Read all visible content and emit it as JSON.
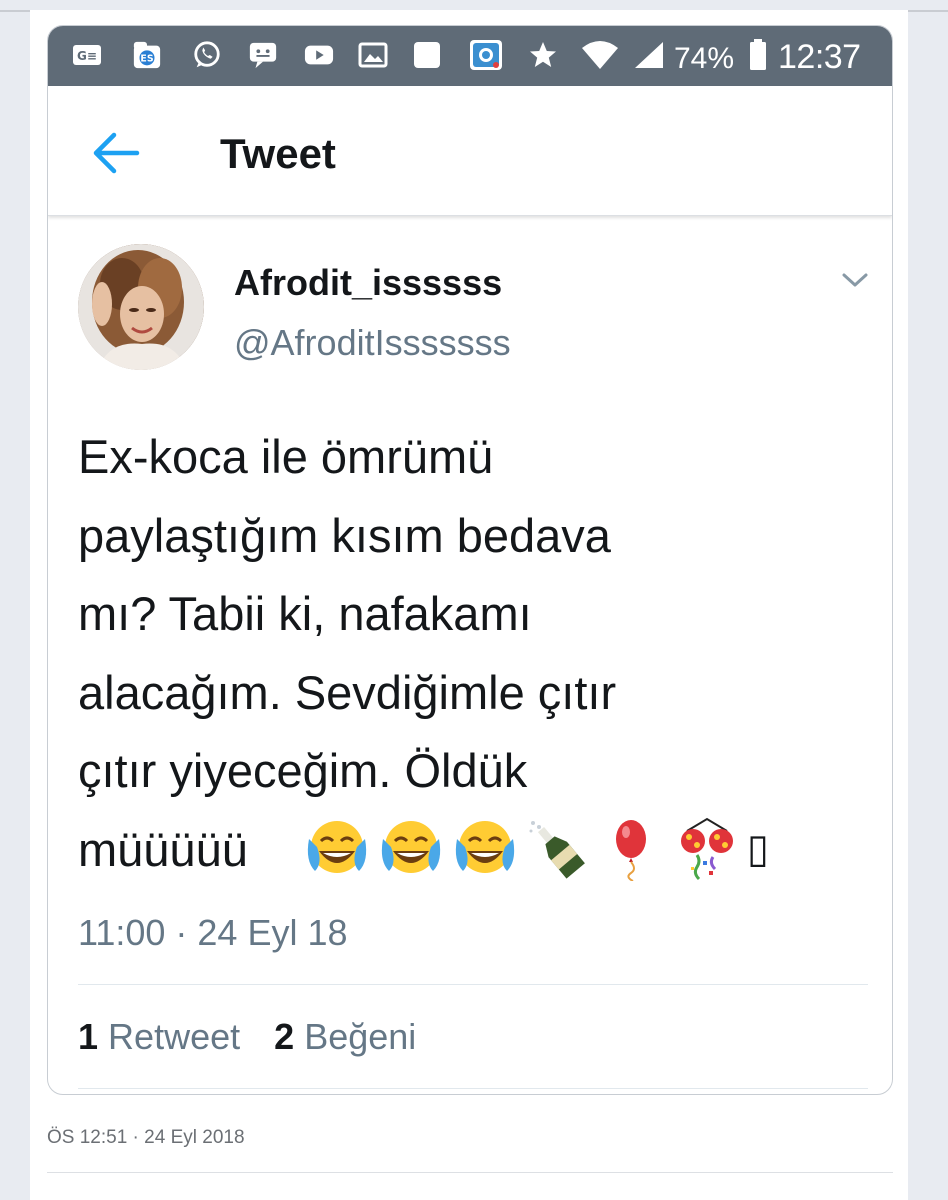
{
  "statusbar": {
    "battery": "74%",
    "time": "12:37",
    "icons": [
      "ge-app-icon",
      "es-file-explorer-icon",
      "whatsapp-icon",
      "messenger-icon",
      "youtube-icon",
      "gallery-icon",
      "blank-app-icon",
      "app-icon",
      "star-icon",
      "wifi-icon",
      "signal-icon",
      "battery-icon"
    ]
  },
  "navbar": {
    "title": "Tweet"
  },
  "tweet": {
    "display_name": "Afrodit_issssss",
    "handle": "@AfroditIsssssss",
    "text": "Ex-koca ile ömrümü\npaylaştığım kısım bedava\nmı? Tabii ki, nafakamı\nalacağım. Sevdiğimle çıtır\nçıtır yiyeceğim. Öldük\nmüüüüü",
    "emojis": [
      "face-with-tears-of-joy",
      "face-with-tears-of-joy",
      "face-with-tears-of-joy",
      "champagne-bottle",
      "balloon",
      "party-popper",
      "missing-glyph"
    ],
    "missing_glyph": "▯",
    "timestamp": "11:00 · 24 Eyl 18",
    "retweets_count": "1",
    "retweets_label": "Retweet",
    "likes_count": "2",
    "likes_label": "Beğeni"
  },
  "footer": {
    "timestamp": "ÖS 12:51 · 24 Eyl 2018"
  },
  "colors": {
    "statusbar": "#5f6b77",
    "accent_blue": "#1da1f2",
    "text_primary": "#14171a",
    "text_secondary": "#657786",
    "page_bg": "#e8ebf1"
  }
}
